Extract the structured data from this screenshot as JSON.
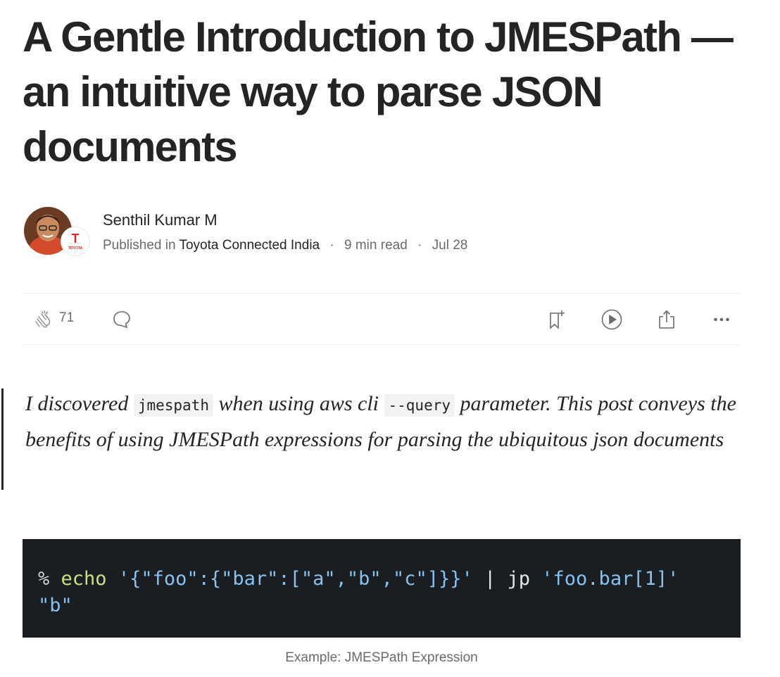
{
  "article": {
    "title": "A Gentle Introduction to JMESPath — an intuitive way to parse JSON documents"
  },
  "author": {
    "name": "Senthil Kumar M",
    "published_in_label": "Published in",
    "publication": "Toyota Connected India",
    "read_time": "9 min read",
    "date": "Jul 28",
    "separator": "·",
    "badge_letter": "T",
    "badge_text": "TOYOTA"
  },
  "actions": {
    "clap_count": "71"
  },
  "quote": {
    "part1": "I discovered ",
    "code1": "jmespath",
    "part2": " when using aws cli ",
    "code2": "--query",
    "part3": " parameter. This post conveys the benefits of using JMESPath expressions for parsing the ubiquitous json documents"
  },
  "code": {
    "prompt": "% ",
    "command": "echo",
    "space1": " ",
    "json_arg": "'{\"foo\":{\"bar\":[\"a\",\"b\",\"c\"]}}'",
    "pipe": " | jp ",
    "query_arg": "'foo.bar[1]'",
    "output": "\"b\""
  },
  "caption": "Example: JMESPath Expression",
  "colors": {
    "text": "#242424",
    "muted": "#6b6b6b",
    "code_bg": "#1a1d21",
    "code_command": "#c8e07e",
    "code_string": "#88c3f0"
  }
}
